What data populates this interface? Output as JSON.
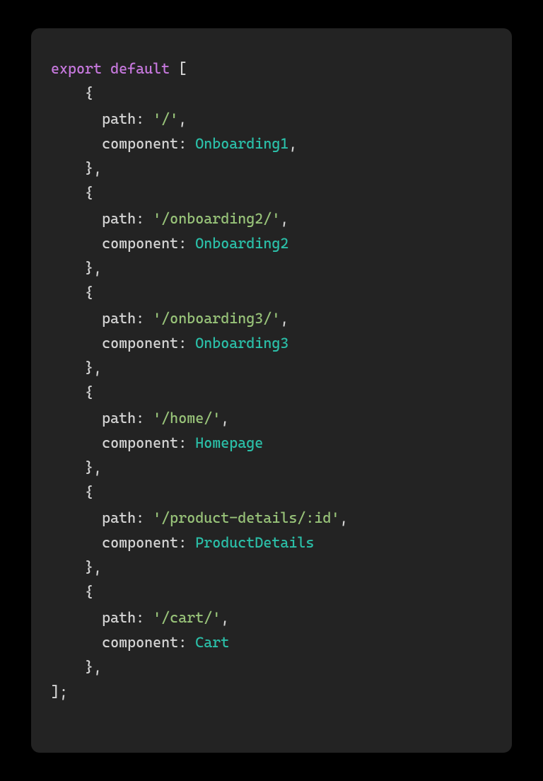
{
  "keywords": {
    "export": "export",
    "default": "default"
  },
  "routes": [
    {
      "path_key": "path",
      "path_val": "'/'",
      "comp_key": "component",
      "comp_val": "Onboarding1",
      "trailing_comma": true
    },
    {
      "path_key": "path",
      "path_val": "'/onboarding2/'",
      "comp_key": "component",
      "comp_val": "Onboarding2",
      "trailing_comma": false
    },
    {
      "path_key": "path",
      "path_val": "'/onboarding3/'",
      "comp_key": "component",
      "comp_val": "Onboarding3",
      "trailing_comma": false
    },
    {
      "path_key": "path",
      "path_val": "'/home/'",
      "comp_key": "component",
      "comp_val": "Homepage",
      "trailing_comma": false
    },
    {
      "path_key": "path",
      "path_val": "'/product-details/:id'",
      "comp_key": "component",
      "comp_val": "ProductDetails",
      "trailing_comma": false
    },
    {
      "path_key": "path",
      "path_val": "'/cart/'",
      "comp_key": "component",
      "comp_val": "Cart",
      "trailing_comma": false
    }
  ],
  "punct": {
    "open_bracket": "[",
    "close_bracket": "]",
    "open_brace": "{",
    "close_brace": "}",
    "colon": ":",
    "comma": ",",
    "semicolon": ";"
  }
}
